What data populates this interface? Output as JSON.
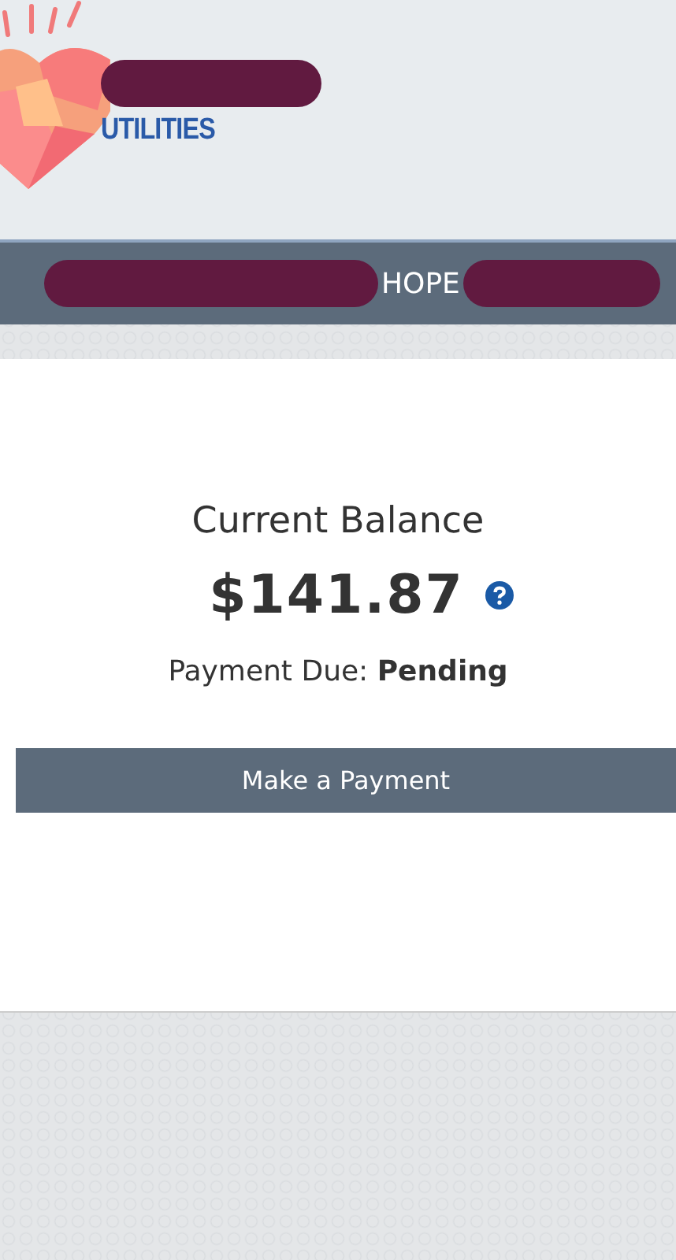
{
  "header": {
    "logo_text": "UTILITIES"
  },
  "nav": {
    "name_visible": "HOPE"
  },
  "balance": {
    "title": "Current Balance",
    "amount": "$141.87",
    "due": "Payment Due: **Pending**",
    "button": "Make a Payment"
  }
}
